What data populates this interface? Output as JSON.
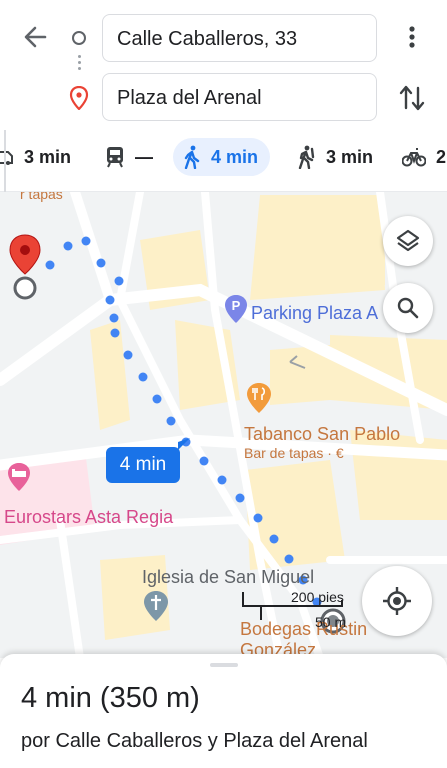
{
  "search": {
    "origin_value": "Calle Caballeros, 33",
    "destination_value": "Plaza del Arenal"
  },
  "modes": [
    {
      "icon": "car-icon",
      "label": "3 min"
    },
    {
      "icon": "transit-icon",
      "label": "—"
    },
    {
      "icon": "walk-icon",
      "label": "4 min",
      "active": true
    },
    {
      "icon": "rideshare-icon",
      "label": "3 min"
    },
    {
      "icon": "bike-icon",
      "label": "2"
    }
  ],
  "map": {
    "labels": {
      "tapas_fragment": "r tapas",
      "parking": "Parking Plaza A",
      "tabanco": "Tabanco San Pablo",
      "tabanco_sub": "Bar de tapas · €",
      "eurostars": "Eurostars Asta Regia",
      "iglesia": "Iglesia de San Miguel",
      "bodegas_1": "Bodegas Rustin",
      "bodegas_2": "González"
    },
    "route_time": "4 min",
    "scale_feet": "200 pies",
    "scale_meters": "50 m",
    "route_color": "#4285f4"
  },
  "sheet": {
    "duration": "4 min",
    "distance": "(350 m)",
    "via": "por Calle Caballeros y Plaza del Arenal"
  },
  "colors": {
    "accent": "#1a73e8",
    "pin_red": "#ea4335",
    "map_bg": "#f1f3f4",
    "block_yellow": "#fdf0c8"
  }
}
